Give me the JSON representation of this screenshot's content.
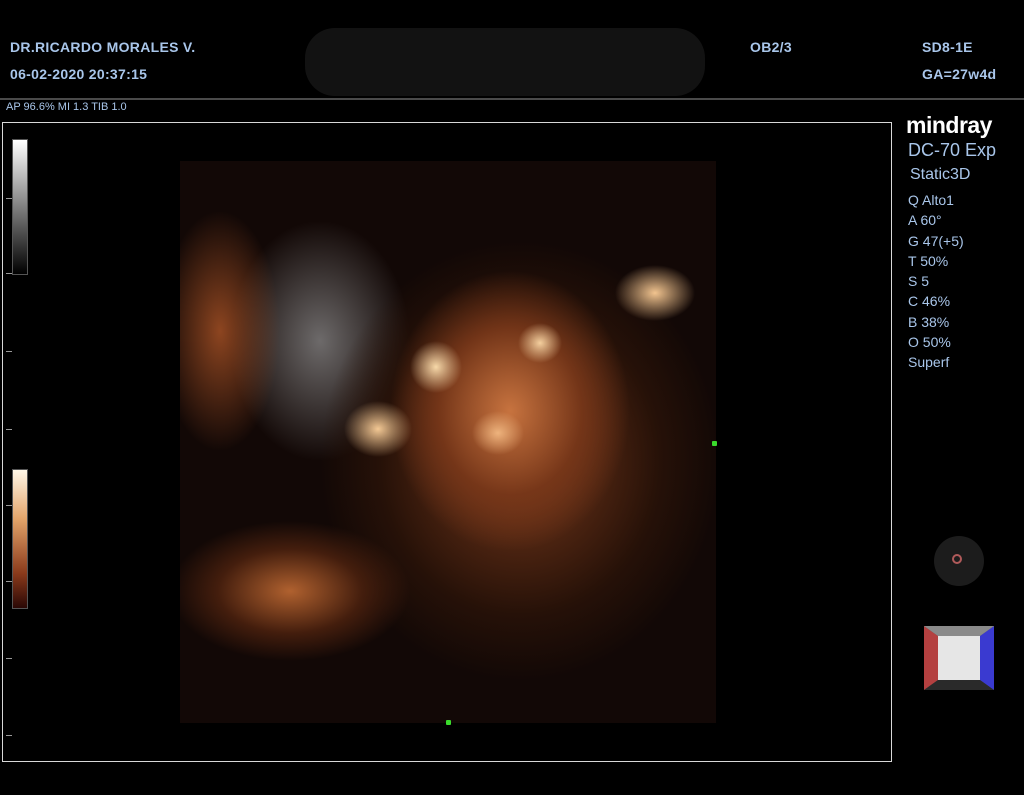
{
  "header": {
    "doctor": "DR.RICARDO MORALES V.",
    "datetime": "06-02-2020  20:37:15",
    "preset": "OB2/3",
    "probe": "SD8-1E",
    "ga": "GA=27w4d"
  },
  "status_line": "AP 96.6%  MI 1.3  TIB 1.0",
  "side": {
    "brand": "mindray",
    "model": "DC-70 Exp",
    "mode": "Static3D",
    "params": [
      "Q Alto1",
      "A 60°",
      "G 47(+5)",
      "T 50%",
      "S 5",
      "C 46%",
      "B 38%",
      "O 50%",
      "Superf"
    ]
  },
  "colors": {
    "text": "#a9c6ea",
    "marker": "#3adb2c",
    "cube_left": "#b44040",
    "cube_right": "#3a3ad0"
  },
  "icons": {
    "knob": "trackball-icon",
    "cube": "orientation-cube-icon"
  }
}
